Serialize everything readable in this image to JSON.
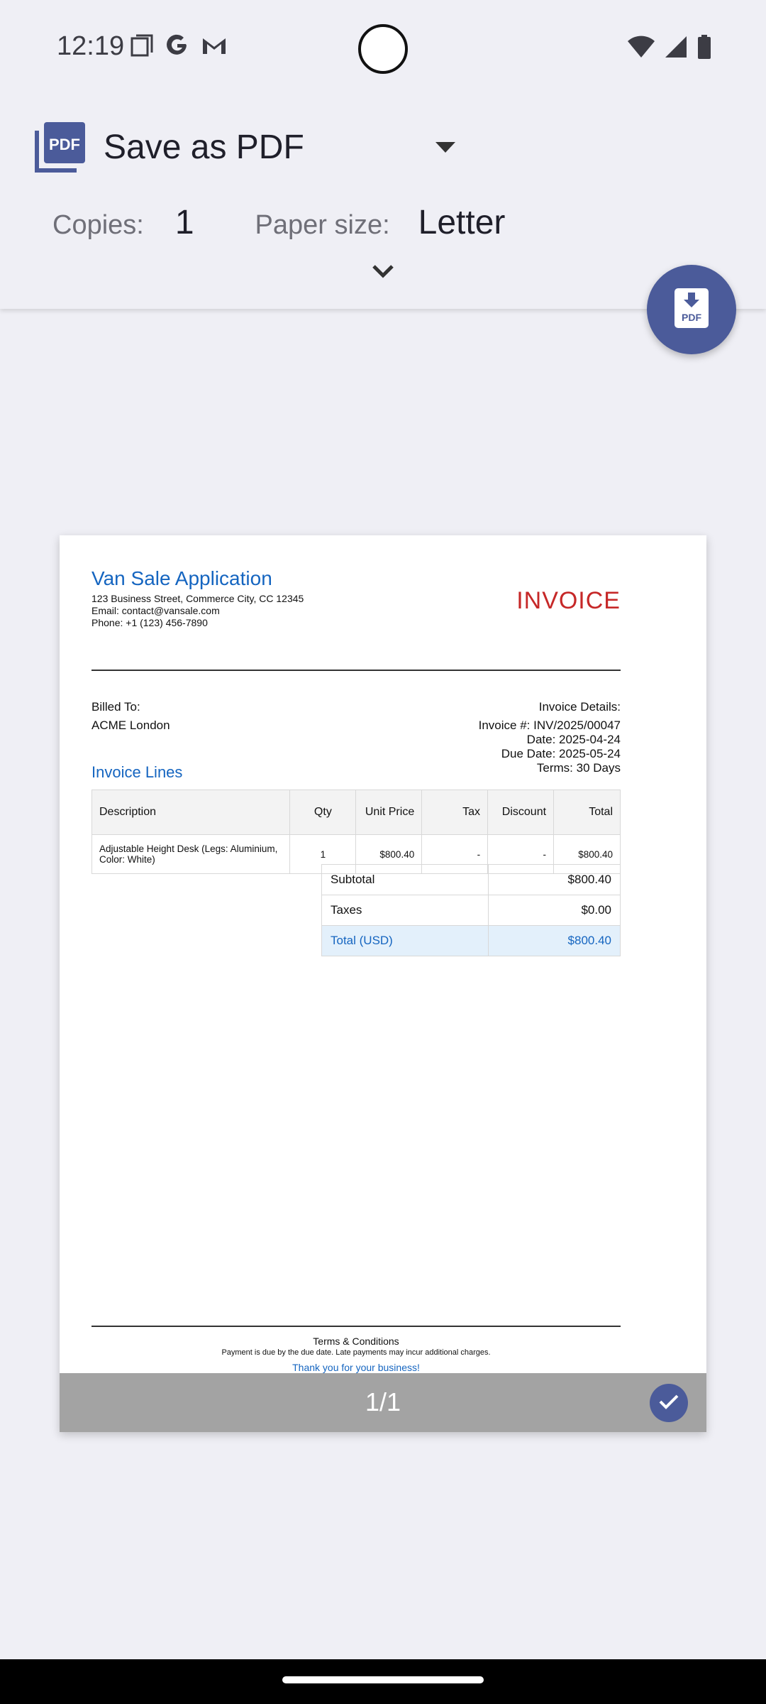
{
  "status": {
    "time": "12:19",
    "left_icons": [
      "copy-icon",
      "google-icon",
      "gmail-icon"
    ],
    "right_icons": [
      "wifi-icon",
      "signal-icon",
      "battery-icon"
    ]
  },
  "print_header": {
    "printer_icon": "pdf-icon",
    "printer_name": "Save as PDF",
    "copies_label": "Copies:",
    "copies_value": "1",
    "paper_size_label": "Paper size:",
    "paper_size_value": "Letter",
    "expand_icon": "chevron-down-icon"
  },
  "fab": {
    "icon": "pdf-download-icon",
    "label": "PDF"
  },
  "invoice": {
    "company_name": "Van Sale Application",
    "address": "123 Business Street, Commerce City, CC 12345",
    "email": "Email: contact@vansale.com",
    "phone": "Phone: +1 (123) 456-7890",
    "title": "INVOICE",
    "billed_to_label": "Billed To:",
    "billed_to_name": "ACME London",
    "details_label": "Invoice Details:",
    "invoice_number": "Invoice #: INV/2025/00047",
    "date": "Date: 2025-04-24",
    "due_date": "Due Date: 2025-05-24",
    "terms": "Terms: 30 Days",
    "lines_title": "Invoice Lines",
    "columns": [
      "Description",
      "Qty",
      "Unit Price",
      "Tax",
      "Discount",
      "Total"
    ],
    "lines": [
      {
        "description": "Adjustable Height Desk (Legs: Aluminium, Color: White)",
        "qty": "1",
        "unit_price": "$800.40",
        "tax": "-",
        "discount": "-",
        "total": "$800.40"
      }
    ],
    "subtotal_label": "Subtotal",
    "subtotal_value": "$800.40",
    "taxes_label": "Taxes",
    "taxes_value": "$0.00",
    "total_label": "Total (USD)",
    "total_value": "$800.40",
    "terms_heading": "Terms & Conditions",
    "terms_text": "Payment is due by the due date. Late payments may incur additional charges.",
    "thanks": "Thank you for your business!"
  },
  "preview": {
    "page_indicator": "1/1",
    "selected_icon": "check-icon"
  },
  "colors": {
    "accent": "#4b5b9a",
    "company_blue": "#1565c0",
    "invoice_red": "#c62828",
    "background": "#efeff5"
  }
}
